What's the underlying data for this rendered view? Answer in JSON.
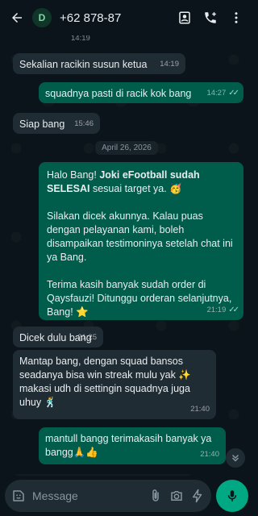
{
  "header": {
    "avatar_initial": "D",
    "contact_name": "+62 878-87"
  },
  "chat": {
    "top_partial_time": "14:19",
    "date_separator": "April 26, 2026",
    "messages": [
      {
        "dir": "in",
        "text": "Sekalian racikin susun ketua",
        "time": "14:19"
      },
      {
        "dir": "out",
        "text": "squadnya pasti di racik kok bang",
        "time": "14:27"
      },
      {
        "dir": "in",
        "text": "Siap bang",
        "time": "15:46"
      },
      {
        "dir": "out",
        "text_prefix": "Halo Bang! ",
        "text_bold": "Joki eFootball sudah SELESAI",
        "text_suffix": " sesuai target ya. 🥳\n\nSilakan dicek akunnya. Kalau puas dengan pelayanan kami, boleh disampaikan testimoninya setelah chat ini ya Bang.\n\nTerima kasih banyak sudah order di Qaysfauzi! Ditunggu orderan selanjutnya, Bang! ⭐",
        "time": "21:19"
      },
      {
        "dir": "in",
        "text": "Dicek dulu bang",
        "time": "21:25"
      },
      {
        "dir": "in",
        "text": "Mantap bang, dengan squad bansos seadanya bisa win streak mulu yak ✨ makasi udh di settingin squadnya juga uhuy 🕺",
        "time": "21:40"
      },
      {
        "dir": "out",
        "text": "mantull bangg terimakasih banyak ya bangg🙏👍",
        "time": "21:40"
      }
    ]
  },
  "composer": {
    "placeholder": "Message"
  },
  "colors": {
    "background": "#0b141a",
    "incoming_bubble": "#202c33",
    "outgoing_bubble": "#005c4b",
    "accent": "#00a884",
    "read_ticks": "#53bdeb"
  }
}
